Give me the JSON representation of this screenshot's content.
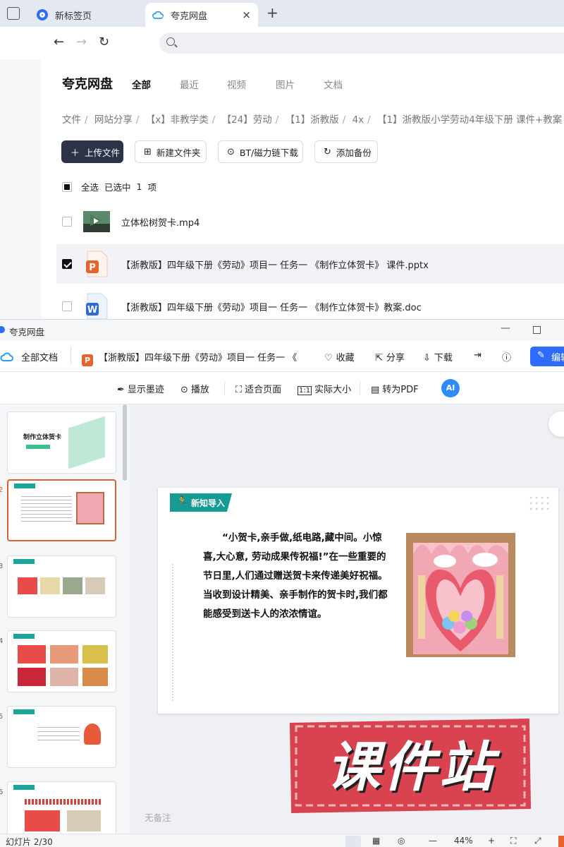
{
  "browser": {
    "tabs": [
      {
        "title": "新标签页",
        "favicon_color": "#2f6bff"
      },
      {
        "title": "夸克网盘",
        "favicon_color": "#2f9bff",
        "active": true
      }
    ],
    "close_glyph": "×",
    "new_tab_glyph": "+",
    "nav": {
      "back": "←",
      "forward": "→",
      "reload": "↻"
    }
  },
  "drive": {
    "app_title": "夸克网盘",
    "categories": [
      "全部",
      "最近",
      "视频",
      "图片",
      "文档"
    ],
    "active_category": "全部",
    "breadcrumb": [
      "文件",
      "网站分享",
      "【x】非教学类",
      "【24】劳动",
      "【1】浙教版",
      "4x",
      "【1】浙教版小学劳动4年级下册 课件+教案"
    ],
    "breadcrumb_sep": "/",
    "actions": {
      "upload": "上传文件",
      "new_folder": "新建文件夹",
      "bt_download": "BT/磁力链下载",
      "backup": "添加备份"
    },
    "selection": {
      "select_all": "全选",
      "selected_label": "已选中",
      "count": "1",
      "unit": "项"
    },
    "files": [
      {
        "name": "立体松树贺卡.mp4",
        "type": "video",
        "selected": false
      },
      {
        "name": "【浙教版】四年级下册《劳动》项目一 任务一 《制作立体贺卡》 课件.pptx",
        "type": "pptx",
        "selected": true
      },
      {
        "name": "【浙教版】四年级下册《劳动》项目一 任务一 《制作立体贺卡》教案.doc",
        "type": "doc",
        "selected": false
      }
    ]
  },
  "viewer": {
    "window_title": "夸克网盘",
    "toolbar": {
      "all_docs": "全部文档",
      "doc_title": "【浙教版】四年级下册《劳动》项目一 任务一 《",
      "ppt_badge": "P",
      "favorite": "收藏",
      "share": "分享",
      "download": "下载",
      "edit": "编辑"
    },
    "toolbar2": {
      "show_ink": "显示墨迹",
      "play": "播放",
      "fit_page": "适合页面",
      "actual_size": "实际大小",
      "to_pdf": "转为PDF",
      "ai": "AI"
    },
    "thumbnails": [
      {
        "num": "",
        "caption": "制作立体贺卡"
      },
      {
        "num": "2",
        "caption": ""
      },
      {
        "num": "3",
        "caption": ""
      },
      {
        "num": "4",
        "caption": ""
      },
      {
        "num": "5",
        "caption": ""
      },
      {
        "num": "6",
        "caption": ""
      }
    ],
    "slide": {
      "tag": "新知导入",
      "body": "“小贺卡,亲手做,纸电路,藏中间。小惊喜,大心意, 劳动成果传祝福!”在一些重要的节日里,人们通过赠送贺卡来传递美好祝福。当收到设计精美、亲手制作的贺卡时,我们都能感受到送卡人的浓浓情谊。"
    },
    "watermark": "课件站",
    "notes": "无备注",
    "status": {
      "slide_counter": "幻灯片 2/30",
      "zoom": "44%",
      "zoom_out": "—",
      "zoom_in": "+"
    }
  },
  "colors": {
    "primary_dark": "#2d3346",
    "accent_blue": "#2f6bff",
    "slide_teal": "#159b93",
    "stamp_red": "#d9434f",
    "thumb_select": "#d7642e"
  }
}
